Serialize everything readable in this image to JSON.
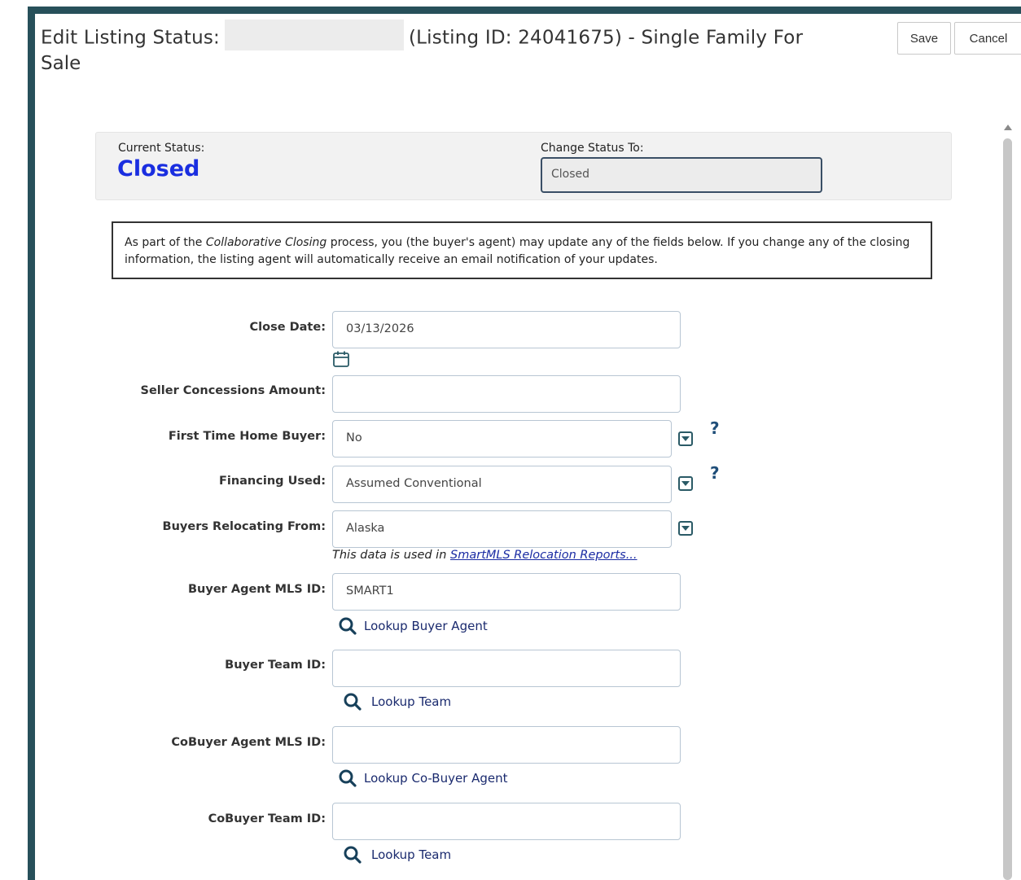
{
  "window": {
    "title_prefix": "Edit Listing Status:",
    "title_suffix": "(Listing ID: 24041675) - Single Family For",
    "title_line2": "Sale",
    "save_label": "Save",
    "cancel_label": "Cancel"
  },
  "status": {
    "current_label": "Current Status:",
    "current_value": "Closed",
    "change_label": "Change Status To:",
    "change_value": "Closed"
  },
  "note": {
    "part1": "As part of the ",
    "emphasis": "Collaborative Closing",
    "part2": " process, you (the buyer's agent) may update any of the fields below. If you change any of the closing information, the listing agent will automatically receive an email notification of your updates."
  },
  "form": {
    "close_date": {
      "label": "Close Date:",
      "value": "03/13/2026"
    },
    "seller_concessions": {
      "label": "Seller Concessions Amount:",
      "value": ""
    },
    "first_time_buyer": {
      "label": "First Time Home Buyer:",
      "value": "No",
      "help": "?"
    },
    "financing_used": {
      "label": "Financing Used:",
      "value": "Assumed Conventional",
      "help": "?"
    },
    "relocating_from": {
      "label": "Buyers Relocating From:",
      "value": "Alaska"
    },
    "relocation_note": {
      "text": "This data is used in ",
      "link": "SmartMLS Relocation Reports..."
    },
    "buyer_agent_id": {
      "label": "Buyer Agent MLS ID:",
      "value": "SMART1",
      "lookup": "Lookup Buyer Agent"
    },
    "buyer_team_id": {
      "label": "Buyer Team ID:",
      "value": "",
      "lookup": "Lookup Team"
    },
    "cobuyer_agent_id": {
      "label": "CoBuyer Agent MLS ID:",
      "value": "",
      "lookup": "Lookup Co-Buyer Agent"
    },
    "cobuyer_team_id": {
      "label": "CoBuyer Team ID:",
      "value": "",
      "lookup": "Lookup Team"
    }
  },
  "colors": {
    "frame": "#27505a",
    "status_value": "#1a2ee0",
    "link": "#1a2ba3"
  },
  "icons": [
    "calendar-icon",
    "dropdown-icon",
    "help-icon",
    "search-icon"
  ]
}
